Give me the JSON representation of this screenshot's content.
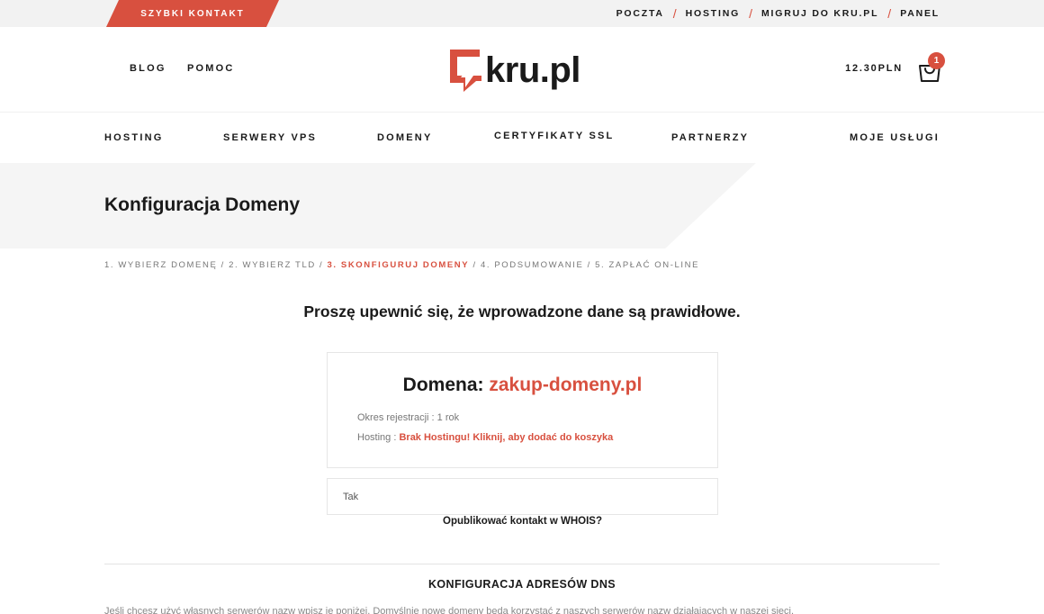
{
  "topbar": {
    "quick_contact": "SZYBKI KONTAKT",
    "links": [
      "POCZTA",
      "HOSTING",
      "MIGRUJ DO KRU.PL",
      "PANEL"
    ]
  },
  "header": {
    "left_links": [
      "BLOG",
      "POMOC"
    ],
    "logo_text": "kru.pl",
    "cart_total": "12.30PLN",
    "cart_count": "1"
  },
  "mainnav": {
    "items": [
      "HOSTING",
      "SERWERY VPS",
      "DOMENY",
      "CERTYFIKATY SSL",
      "PARTNERZY",
      "MOJE USŁUGI"
    ]
  },
  "page": {
    "title": "Konfiguracja Domeny"
  },
  "breadcrumb": {
    "steps": [
      "1. WYBIERZ DOMENĘ",
      "2. WYBIERZ TLD",
      "3. SKONFIGURUJ DOMENY",
      "4. PODSUMOWANIE",
      "5. ZAPŁAĆ ON-LINE"
    ],
    "separator": "/",
    "active_index": 2
  },
  "notice": "Proszę upewnić się, że wprowadzone dane są prawidłowe.",
  "domain_card": {
    "label": "Domena: ",
    "domain": "zakup-domeny.pl",
    "period_label": "Okres rejestracji : ",
    "period_value": "1 rok",
    "hosting_label": "Hosting : ",
    "hosting_link": "Brak Hostingu! Kliknij, aby dodać do koszyka"
  },
  "whois": {
    "selected": "Tak",
    "label": "Opublikować kontakt w WHOIS?"
  },
  "dns": {
    "title": "KONFIGURACJA ADRESÓW DNS",
    "description": "Jeśli chcesz użyć własnych serwerów nazw wpisz je poniżej. Domyślnie nowe domeny będą korzystać z naszych serwerów nazw działających w naszej sieci."
  },
  "colors": {
    "accent": "#d8503f",
    "text": "#1a1a1a",
    "muted": "#777777",
    "topbar_bg": "#f2f2f2"
  },
  "icons": [
    "logo-mark-icon",
    "shopping-bag-icon"
  ]
}
